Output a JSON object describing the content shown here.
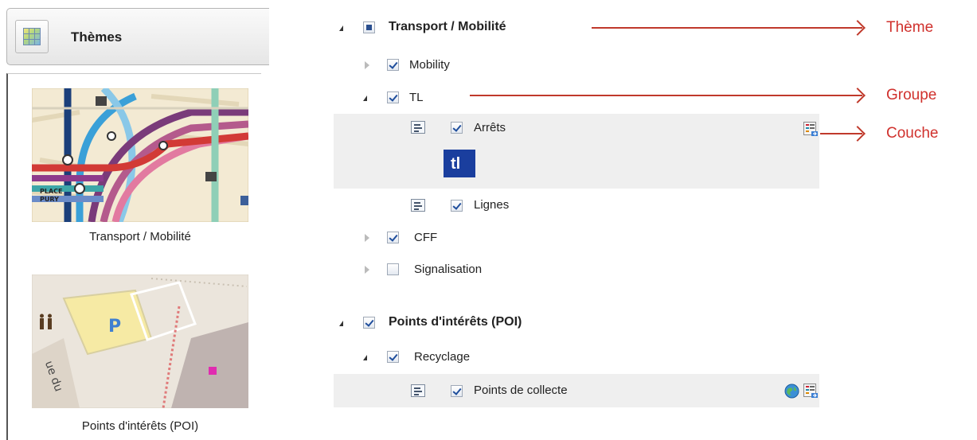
{
  "themes_panel": {
    "title": "Thèmes",
    "themes": [
      {
        "label": "Transport / Mobilité",
        "thumbnail": "transport-map-thumbnail"
      },
      {
        "label": "Points d'intérêts (POI)",
        "thumbnail": "poi-map-thumbnail"
      }
    ]
  },
  "tree": {
    "theme_transport": {
      "label": "Transport / Mobilité",
      "state": "partial"
    },
    "group_mobility": {
      "label": "Mobility",
      "checked": true
    },
    "group_tl": {
      "label": "TL",
      "checked": true
    },
    "layer_arrets": {
      "label": "Arrêts",
      "checked": true,
      "legend_logo": "tl"
    },
    "layer_lignes": {
      "label": "Lignes",
      "checked": true
    },
    "group_cff": {
      "label": "CFF",
      "checked": true
    },
    "group_signalisation": {
      "label": "Signalisation",
      "checked": false
    },
    "theme_poi": {
      "label": "Points d'intérêts (POI)",
      "checked": true
    },
    "group_recyclage": {
      "label": "Recyclage",
      "checked": true
    },
    "layer_points_collecte": {
      "label": "Points de collecte",
      "checked": true
    }
  },
  "annotations": {
    "theme": "Thème",
    "group": "Groupe",
    "layer": "Couche"
  },
  "colors": {
    "annotation": "#d0312d",
    "tl_logo_bg": "#1a3e9e",
    "row_highlight": "#efefef"
  }
}
